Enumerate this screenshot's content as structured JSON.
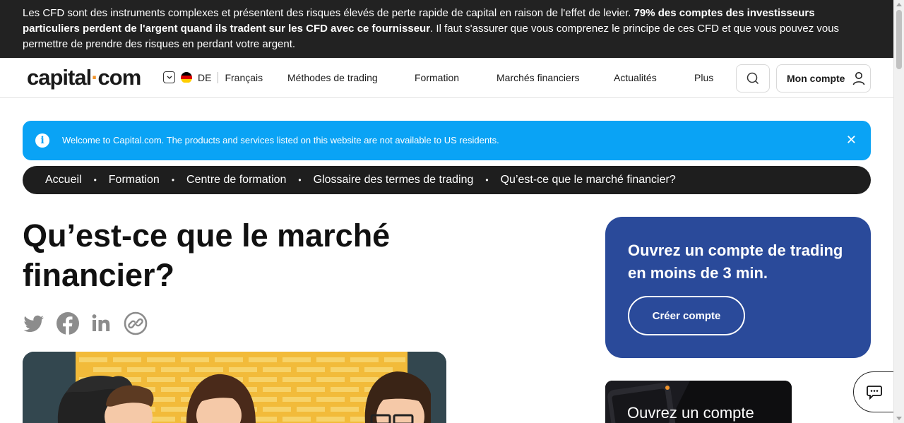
{
  "risk_banner": {
    "text_start": "Les CFD sont des instruments complexes et présentent des risques élevés de perte rapide de capital en raison de l'effet de levier. ",
    "text_bold": "79% des comptes des investisseurs particuliers perdent de l'argent quand ils tradent sur les CFD avec ce fournisseur",
    "text_end": ". Il faut s'assurer que vous comprenez le principe de ces CFD et que vous pouvez vous permettre de prendre des risques en perdant votre argent."
  },
  "header": {
    "logo_left": "capital",
    "logo_dot": "·",
    "logo_right": "com",
    "country_code": "DE",
    "language": "Français",
    "nav": [
      "Méthodes de trading",
      "Formation",
      "Marchés financiers",
      "Actualités",
      "Plus"
    ],
    "account_label": "Mon compte"
  },
  "alert": {
    "icon": "i",
    "message": "Welcome to Capital.com. The products and services listed on this website are not available to US residents.",
    "close": "✕"
  },
  "breadcrumb": [
    "Accueil",
    "Formation",
    "Centre de formation",
    "Glossaire des termes de trading",
    "Qu’est-ce que le marché financier?"
  ],
  "breadcrumb_separator": "•",
  "article": {
    "title": "Qu’est-ce que le marché financier?"
  },
  "cta": {
    "heading": "Ouvrez un compte de trading en moins de 3 min.",
    "button": "Créer compte"
  },
  "promo": {
    "text": "Ouvrez un compte"
  },
  "colors": {
    "risk_bg": "#222222",
    "alert_bg": "#0aa3f5",
    "breadcrumb_bg": "#1e1e1e",
    "cta_bg": "#2a4a9a",
    "logo_dot": "#f0932b",
    "share_icon": "#8c8c8c"
  },
  "icons": [
    "chevron-down-icon",
    "germany-flag-icon",
    "search-icon",
    "user-icon",
    "info-icon",
    "close-icon",
    "twitter-icon",
    "facebook-icon",
    "linkedin-icon",
    "link-icon",
    "chat-icon"
  ]
}
